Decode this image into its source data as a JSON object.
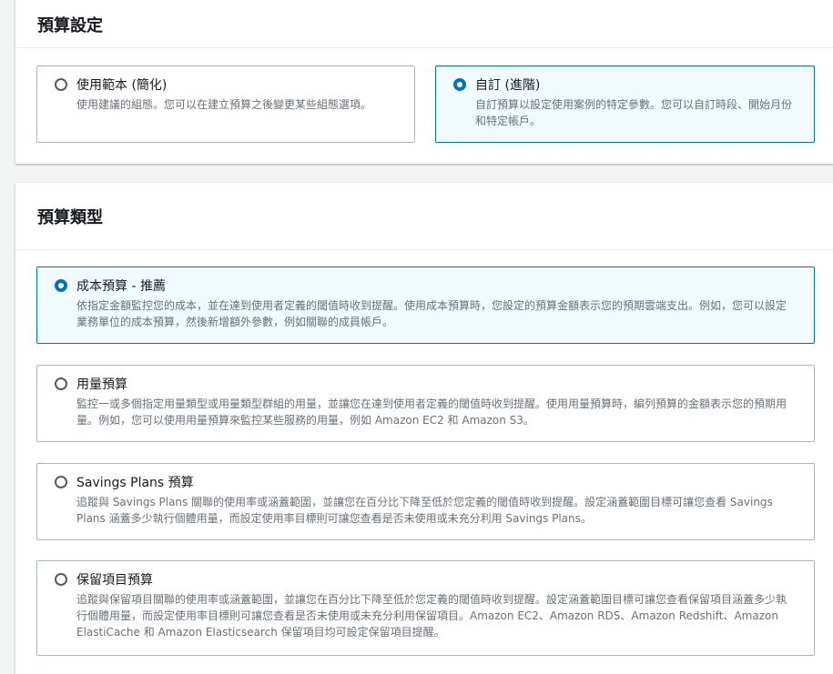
{
  "budget_setup": {
    "title": "預算設定",
    "options": [
      {
        "label": "使用範本 (簡化)",
        "description": "使用建議的組態。您可以在建立預算之後變更某些組態選項。",
        "selected": false
      },
      {
        "label": "自訂 (進階)",
        "description": "自訂預算以設定使用案例的特定參數。您可以自訂時段、開始月份和特定帳戶。",
        "selected": true
      }
    ]
  },
  "budget_type": {
    "title": "預算類型",
    "options": [
      {
        "label": "成本預算 - 推薦",
        "description": "依指定金額監控您的成本，並在達到使用者定義的閾值時收到提醒。使用成本預算時，您設定的預算金額表示您的預期雲端支出。例如，您可以設定業務單位的成本預算，然後新增額外參數，例如關聯的成員帳戶。",
        "selected": true
      },
      {
        "label": "用量預算",
        "description": "監控一或多個指定用量類型或用量類型群組的用量，並讓您在達到使用者定義的閾值時收到提醒。使用用量預算時，編列預算的金額表示您的預期用量。例如，您可以使用用量預算來監控某些服務的用量，例如 Amazon EC2 和 Amazon S3。",
        "selected": false
      },
      {
        "label": "Savings Plans 預算",
        "description": "追蹤與 Savings Plans 關聯的使用率或涵蓋範圍，並讓您在百分比下降至低於您定義的閾值時收到提醒。設定涵蓋範圍目標可讓您查看 Savings Plans 涵蓋多少執行個體用量，而設定使用率目標則可讓您查看是否未使用或未充分利用 Savings Plans。",
        "selected": false
      },
      {
        "label": "保留項目預算",
        "description": "追蹤與保留項目關聯的使用率或涵蓋範圍，並讓您在百分比下降至低於您定義的閾值時收到提醒。設定涵蓋範圍目標可讓您查看保留項目涵蓋多少執行個體用量，而設定使用率目標則可讓您查看是否未使用或未充分利用保留項目。Amazon EC2、Amazon RDS、Amazon Redshift、Amazon ElastiCache 和 Amazon Elasticsearch 保留項目均可設定保留項目提醒。",
        "selected": false
      }
    ]
  },
  "colors": {
    "accent": "#0073bb",
    "selected_bg": "#f1faff",
    "border": "#aab7b8",
    "muted_text": "#687078"
  }
}
